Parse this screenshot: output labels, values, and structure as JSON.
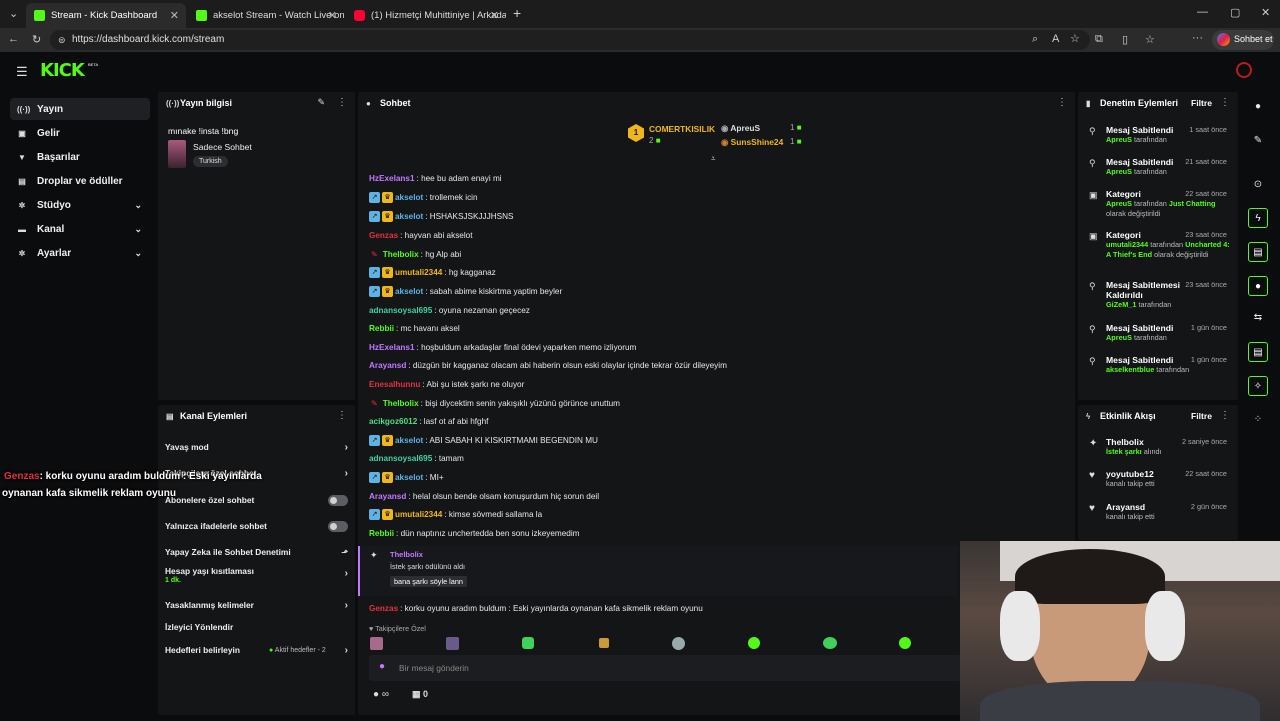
{
  "browser": {
    "tabs": [
      {
        "title": "Stream - Kick Dashboard",
        "active": true,
        "icon": "kick-icon"
      },
      {
        "title": "akselot Stream - Watch Live on Kic",
        "active": false,
        "icon": "kick-icon"
      },
      {
        "title": "(1) Hizmetçi Muhittiniye | Arkadaş",
        "active": false,
        "icon": "youtube-icon"
      }
    ],
    "url": "https://dashboard.kick.com/stream",
    "profile_button": "Sohbet et"
  },
  "brand": {
    "logo": "KICK",
    "beta": "BETA",
    "accent": "#53fc18"
  },
  "sidebar": {
    "items": [
      {
        "label": "Yayın",
        "icon": "broadcast-icon",
        "chevron": false
      },
      {
        "label": "Gelir",
        "icon": "money-icon",
        "chevron": false
      },
      {
        "label": "Başarılar",
        "icon": "trophy-icon",
        "chevron": false
      },
      {
        "label": "Droplar ve ödüller",
        "icon": "gift-icon",
        "chevron": false
      },
      {
        "label": "Stüdyo",
        "icon": "gear-icon",
        "chevron": true
      },
      {
        "label": "Kanal",
        "icon": "channel-icon",
        "chevron": true
      },
      {
        "label": "Ayarlar",
        "icon": "settings-icon",
        "chevron": true
      }
    ]
  },
  "stream_info": {
    "header": "Yayın bilgisi",
    "title": "mınake !insta !bng",
    "category": "Sadece Sohbet",
    "tag": "Turkish"
  },
  "channel_actions": {
    "header": "Kanal Eylemleri",
    "rows": [
      {
        "label": "Yavaş mod",
        "control": "chevron"
      },
      {
        "label": "Takipçilere özel sohbet",
        "control": "chevron"
      },
      {
        "label": "Abonelere özel sohbet",
        "control": "toggle"
      },
      {
        "label": "Yalnızca ifadelerle sohbet",
        "control": "toggle"
      },
      {
        "label": "Yapay Zeka ile Sohbet Denetimi",
        "control": "chart"
      },
      {
        "label": "Hesap yaşı kısıtlaması",
        "sub": "1 dk.",
        "control": "chevron"
      },
      {
        "label": "Yasaklanmış kelimeler",
        "control": "chevron"
      },
      {
        "label": "İzleyici Yönlendir",
        "control": "none"
      },
      {
        "label": "Hedefleri belirleyin",
        "extra": "Aktif hedefler - 2",
        "control": "chevron"
      }
    ]
  },
  "overlay": {
    "user": "Genzas",
    "line1": ": korku oyunu aradım buldum : Eski yayınlarda",
    "line2": "oynanan kafa sikmelik reklam oyunu"
  },
  "chat": {
    "header": "Sohbet",
    "leaderboard": {
      "first": {
        "rank": "1",
        "name": "COMERTKISILIK",
        "count": "2"
      },
      "second": {
        "name": "ApreuS",
        "count": "1"
      },
      "third": {
        "name": "SunsShine24",
        "count": "1"
      }
    },
    "messages": [
      {
        "user": "HzExelans1",
        "color": "#c179ff",
        "text": ": hee bu adam enayi mi",
        "badges": []
      },
      {
        "user": "akselot",
        "color": "#5fb3e4",
        "text": ": trollemek icin",
        "badges": [
          "b-blue",
          "b-gold"
        ]
      },
      {
        "user": "akselot",
        "color": "#5fb3e4",
        "text": ": HSHAKSJSKJJJHSNS",
        "badges": [
          "b-blue",
          "b-gold"
        ]
      },
      {
        "user": "Genzas",
        "color": "#e1323f",
        "text": ": hayvan abi akselot",
        "badges": []
      },
      {
        "user": "Thelbolix",
        "color": "#53fc18",
        "text": ": hg Alp abi",
        "badges": [
          "pin"
        ]
      },
      {
        "user": "umutali2344",
        "color": "#f0b71b",
        "text": ": hg kagganaz",
        "badges": [
          "b-blue",
          "b-gold"
        ]
      },
      {
        "user": "akselot",
        "color": "#5fb3e4",
        "text": ": sabah abime kiskirtma yaptim beyler",
        "badges": [
          "b-blue",
          "b-gold"
        ]
      },
      {
        "user": "adnansoysal695",
        "color": "#3ed3a0",
        "text": ": oyuna nezaman geçecez",
        "badges": []
      },
      {
        "user": "Rebbii",
        "color": "#53fc18",
        "text": ": mc havanı aksel",
        "badges": []
      },
      {
        "user": "HzExelans1",
        "color": "#c179ff",
        "text": ": hoşbuldum arkadaşlar final ödevi yaparken memo izliyorum",
        "badges": []
      },
      {
        "user": "Arayansd",
        "color": "#c179ff",
        "text": ": düzgün bir kagganaz olacam abi haberin olsun eski olaylar içinde tekrar özür dileyeyim",
        "badges": []
      },
      {
        "user": "Enesalhunnu",
        "color": "#e1323f",
        "text": ": Abi şu istek şarkı ne oluyor",
        "badges": []
      },
      {
        "user": "Thelbolix",
        "color": "#53fc18",
        "text": ": bişi diycektim senin yakışıklı yüzünü görünce unuttum",
        "badges": [
          "pin"
        ]
      },
      {
        "user": "acikgoz6012",
        "color": "#4ade80",
        "text": ": lasf ot af abi hfghf",
        "badges": []
      },
      {
        "user": "akselot",
        "color": "#5fb3e4",
        "text": ": ABI SABAH KI KISKIRTMAMI BEGENDIN MU",
        "badges": [
          "b-blue",
          "b-gold"
        ]
      },
      {
        "user": "adnansoysal695",
        "color": "#3ed3a0",
        "text": ": tamam",
        "badges": []
      },
      {
        "user": "akselot",
        "color": "#5fb3e4",
        "text": ": MI+",
        "badges": [
          "b-blue",
          "b-gold"
        ]
      },
      {
        "user": "Arayansd",
        "color": "#c179ff",
        "text": ": helal olsun bende olsam konuşurdum hiç sorun deil",
        "badges": []
      },
      {
        "user": "umutali2344",
        "color": "#f0b71b",
        "text": ": kimse sövmedi sallama la",
        "badges": [
          "b-blue",
          "b-gold"
        ]
      },
      {
        "user": "Rebbii",
        "color": "#53fc18",
        "text": ": dün naptınız unchertedda ben sonu izkeyemedim",
        "badges": []
      }
    ],
    "reward": {
      "user": "Thelbolix",
      "action": "İstek şarkı ödülünü aldı",
      "text": "bana şarkı söyle lann"
    },
    "last": {
      "user": "Genzas",
      "text": ": korku oyunu aradım buldum : Eski yayınlarda oynanan kafa sikmelik reklam oyunu"
    },
    "followers_only": "Takipçilere Özel",
    "input_placeholder": "Bir mesaj gönderin",
    "infinity": "∞",
    "gift_count": "0"
  },
  "moderation": {
    "header": "Denetim Eylemleri",
    "filter": "Filtre",
    "items": [
      {
        "title": "Mesaj Sabitlendi",
        "by": "ApreuS",
        "suffix": "tarafından",
        "time": "1 saat önce",
        "icon": "pin-icon"
      },
      {
        "title": "Mesaj Sabitlendi",
        "by": "ApreuS",
        "suffix": "tarafından",
        "time": "21 saat önce",
        "icon": "pin-icon"
      },
      {
        "title": "Kategori",
        "by": "ApreuS",
        "suffix": "tarafından",
        "extra": "Just Chatting",
        "extra2": "olarak değiştirildi",
        "time": "22 saat önce",
        "icon": "category-icon"
      },
      {
        "title": "Kategori",
        "by": "umutali2344",
        "suffix": "tarafından",
        "extra": "Uncharted 4: A Thief's End",
        "extra2": "olarak değiştirildi",
        "time": "23 saat önce",
        "icon": "category-icon"
      },
      {
        "title": "Mesaj Sabitlemesi Kaldırıldı",
        "by": "GiZeM_1",
        "suffix": "tarafından",
        "time": "23 saat önce",
        "icon": "unpin-icon"
      },
      {
        "title": "Mesaj Sabitlendi",
        "by": "ApreuS",
        "suffix": "tarafından",
        "time": "1 gün önce",
        "icon": "pin-icon"
      },
      {
        "title": "Mesaj Sabitlendi",
        "by": "akselkentblue",
        "suffix": "tarafından",
        "time": "1 gün önce",
        "icon": "pin-icon"
      }
    ]
  },
  "activity": {
    "header": "Etkinlik Akışı",
    "filter": "Filtre",
    "items": [
      {
        "user": "Thelbolix",
        "text": "İstek şarkı",
        "text2": "alındı",
        "time": "2 saniye önce",
        "icon": "sparkle-icon"
      },
      {
        "user": "yoyutube12",
        "text": "kanalı takip etti",
        "time": "22 saat önce",
        "icon": "heart-icon"
      },
      {
        "user": "Arayansd",
        "text": "kanalı takip etti",
        "time": "2 gün önce",
        "icon": "heart-icon"
      }
    ]
  }
}
